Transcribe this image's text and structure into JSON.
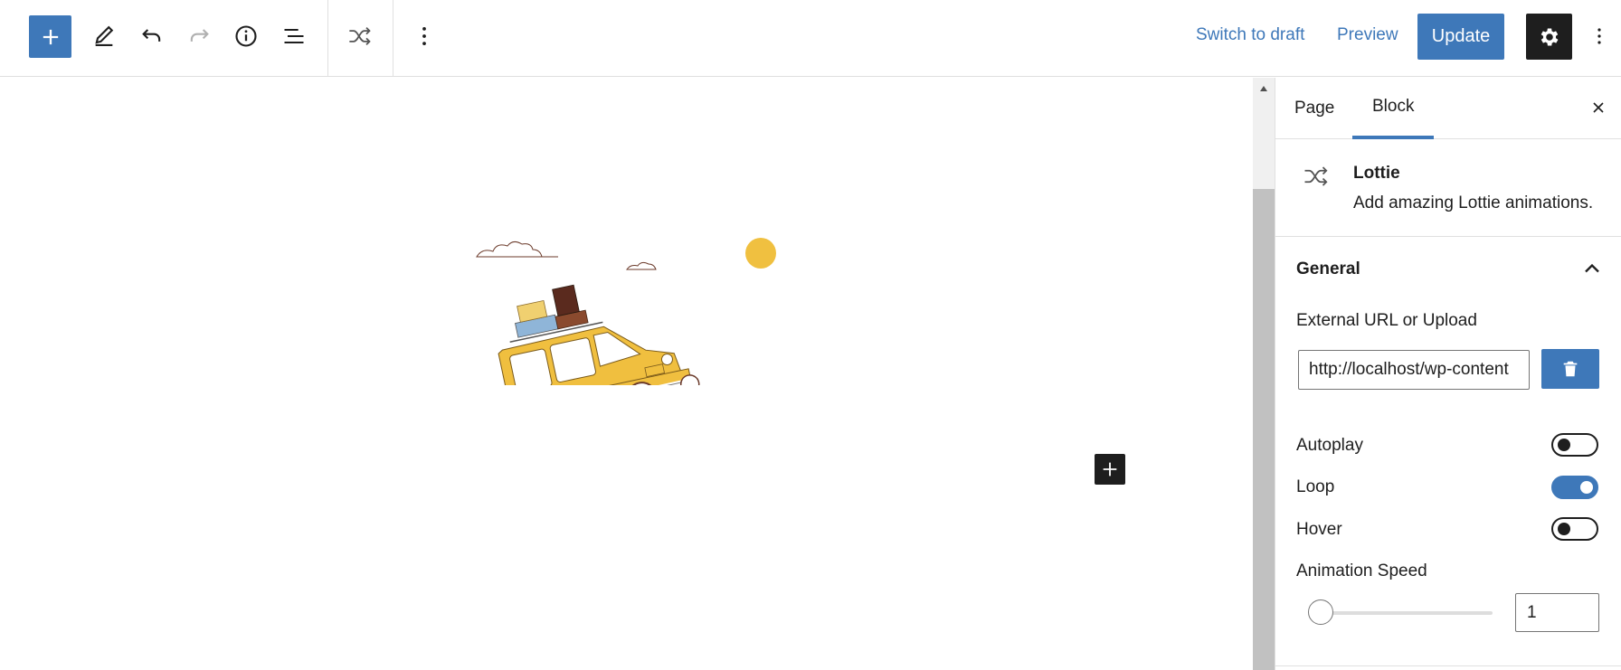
{
  "toolbar": {
    "switch_to_draft": "Switch to draft",
    "preview": "Preview",
    "update": "Update",
    "icons": [
      "plus-icon",
      "pencil-icon",
      "undo-icon",
      "redo-icon",
      "info-icon",
      "list-view-icon",
      "shuffle-icon",
      "more-vertical-icon",
      "gear-icon",
      "more-vertical-icon"
    ]
  },
  "sidebar": {
    "tabs": [
      "Page",
      "Block"
    ],
    "active_tab": "Block",
    "block": {
      "title": "Lottie",
      "description": "Add amazing Lottie animations."
    },
    "panel": {
      "title": "General",
      "url_label": "External URL or Upload",
      "url_value": "http://localhost/wp-content",
      "autoplay_label": "Autoplay",
      "autoplay": false,
      "loop_label": "Loop",
      "loop": true,
      "hover_label": "Hover",
      "hover": false,
      "speed_label": "Animation Speed",
      "speed_value": "1",
      "speed_fraction": 0.05
    }
  },
  "colors": {
    "accent": "#3e78b9",
    "dark": "#1e1e1e",
    "car_yellow": "#f0bf3f",
    "sun": "#f0c040"
  }
}
